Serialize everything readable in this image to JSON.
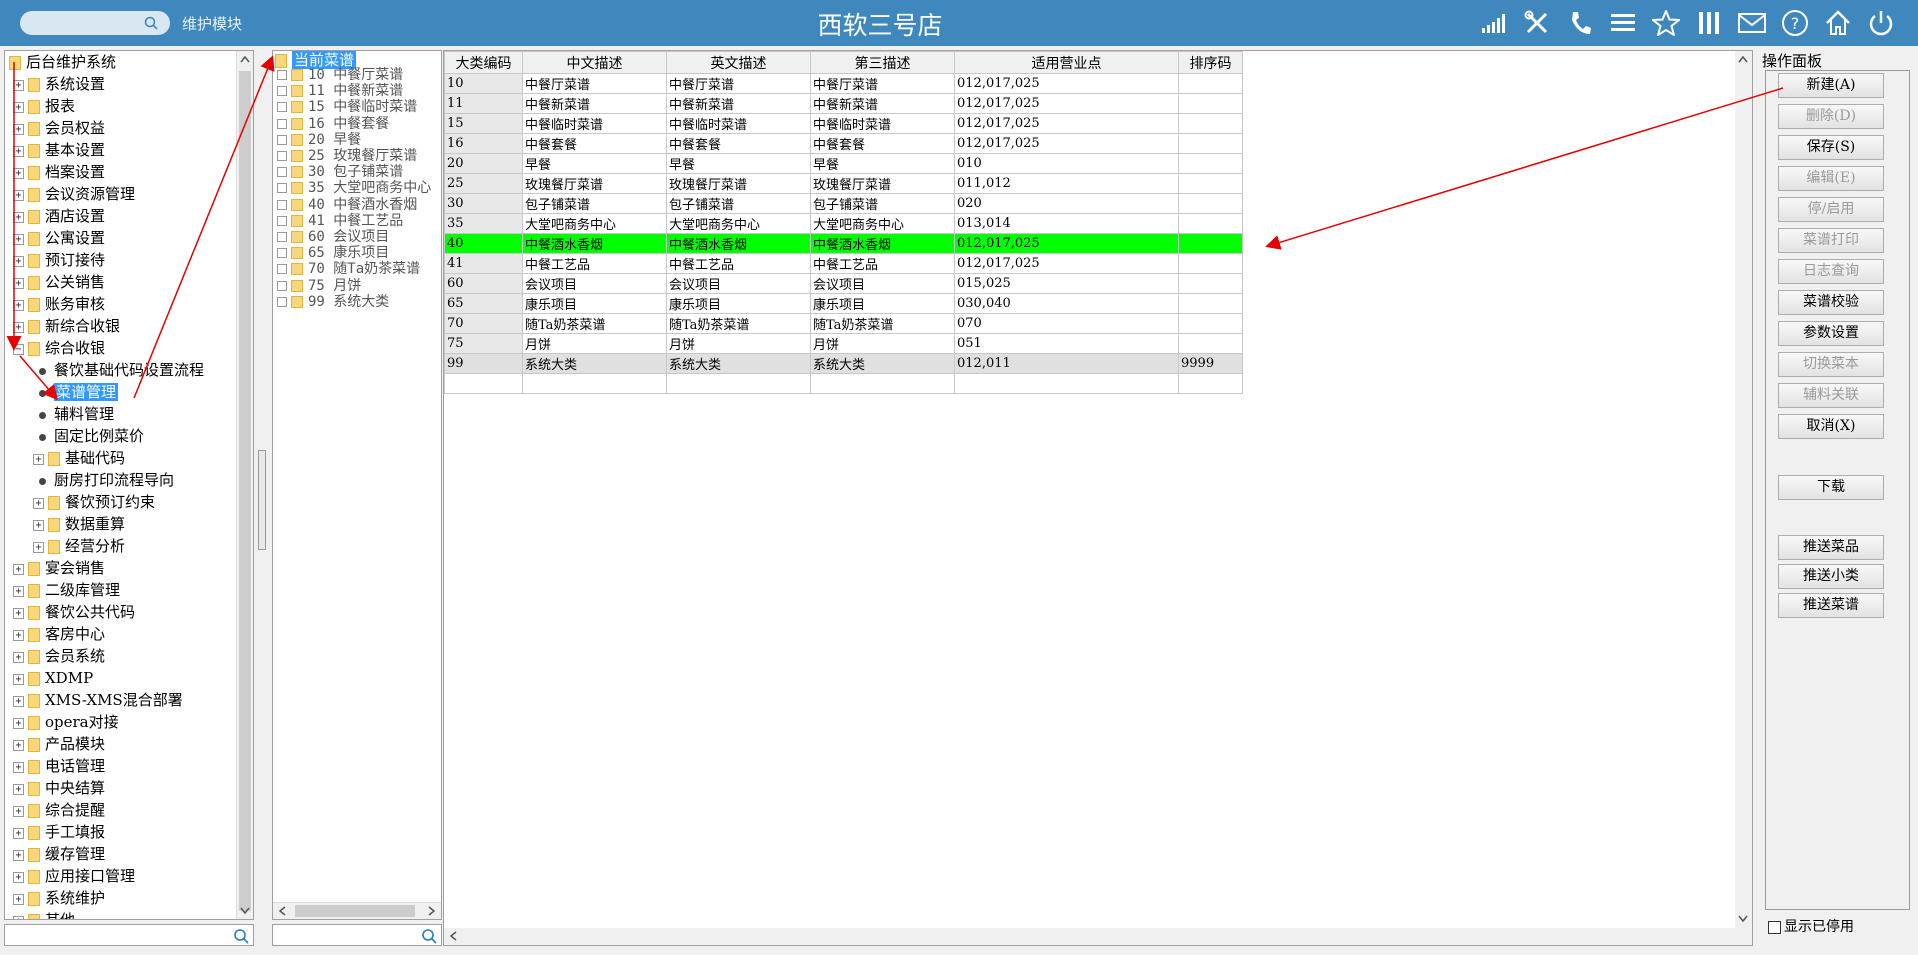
{
  "header": {
    "module_label": "维护模块",
    "title": "西软三号店",
    "icons": [
      "signal-icon",
      "tools-icon",
      "phone-icon",
      "menu-icon",
      "star-icon",
      "columns-icon",
      "mail-icon",
      "help-icon",
      "home-icon",
      "power-icon"
    ]
  },
  "left_tree": {
    "root": "后台维护系统",
    "items": [
      {
        "label": "系统设置",
        "level": 1,
        "type": "folder"
      },
      {
        "label": "报表",
        "level": 1,
        "type": "folder"
      },
      {
        "label": "会员权益",
        "level": 1,
        "type": "folder"
      },
      {
        "label": "基本设置",
        "level": 1,
        "type": "folder"
      },
      {
        "label": "档案设置",
        "level": 1,
        "type": "folder"
      },
      {
        "label": "会议资源管理",
        "level": 1,
        "type": "folder"
      },
      {
        "label": "酒店设置",
        "level": 1,
        "type": "folder"
      },
      {
        "label": "公寓设置",
        "level": 1,
        "type": "folder"
      },
      {
        "label": "预订接待",
        "level": 1,
        "type": "folder"
      },
      {
        "label": "公关销售",
        "level": 1,
        "type": "folder"
      },
      {
        "label": "账务审核",
        "level": 1,
        "type": "folder"
      },
      {
        "label": "新综合收银",
        "level": 1,
        "type": "folder"
      },
      {
        "label": "综合收银",
        "level": 1,
        "type": "folder",
        "expanded": true
      },
      {
        "label": "餐饮基础代码设置流程",
        "level": 2,
        "type": "leaf"
      },
      {
        "label": "菜谱管理",
        "level": 2,
        "type": "leaf",
        "selected": true
      },
      {
        "label": "辅料管理",
        "level": 2,
        "type": "leaf"
      },
      {
        "label": "固定比例菜价",
        "level": 2,
        "type": "leaf"
      },
      {
        "label": "基础代码",
        "level": 2,
        "type": "folder"
      },
      {
        "label": "厨房打印流程导向",
        "level": 2,
        "type": "leaf"
      },
      {
        "label": "餐饮预订约束",
        "level": 2,
        "type": "folder"
      },
      {
        "label": "数据重算",
        "level": 2,
        "type": "folder"
      },
      {
        "label": "经营分析",
        "level": 2,
        "type": "folder"
      },
      {
        "label": "宴会销售",
        "level": 1,
        "type": "folder"
      },
      {
        "label": "二级库管理",
        "level": 1,
        "type": "folder"
      },
      {
        "label": "餐饮公共代码",
        "level": 1,
        "type": "folder"
      },
      {
        "label": "客房中心",
        "level": 1,
        "type": "folder"
      },
      {
        "label": "会员系统",
        "level": 1,
        "type": "folder"
      },
      {
        "label": "XDMP",
        "level": 1,
        "type": "folder"
      },
      {
        "label": "XMS-XMS混合部署",
        "level": 1,
        "type": "folder"
      },
      {
        "label": "opera对接",
        "level": 1,
        "type": "folder"
      },
      {
        "label": "产品模块",
        "level": 1,
        "type": "folder"
      },
      {
        "label": "电话管理",
        "level": 1,
        "type": "folder"
      },
      {
        "label": "中央结算",
        "level": 1,
        "type": "folder"
      },
      {
        "label": "综合提醒",
        "level": 1,
        "type": "folder"
      },
      {
        "label": "手工填报",
        "level": 1,
        "type": "folder"
      },
      {
        "label": "缓存管理",
        "level": 1,
        "type": "folder"
      },
      {
        "label": "应用接口管理",
        "level": 1,
        "type": "folder"
      },
      {
        "label": "系统维护",
        "level": 1,
        "type": "folder"
      },
      {
        "label": "其他",
        "level": 1,
        "type": "folder"
      }
    ]
  },
  "mid_tree": {
    "root": "当前菜谱",
    "items": [
      "10  中餐厅菜谱",
      "11  中餐新菜谱",
      "15  中餐临时菜谱",
      "16  中餐套餐",
      "20  早餐",
      "25  玫瑰餐厅菜谱",
      "30  包子铺菜谱",
      "35  大堂吧商务中心",
      "40  中餐酒水香烟",
      "41  中餐工艺品",
      "60  会议项目",
      "65  康乐项目",
      "70  随Ta奶茶菜谱",
      "75  月饼",
      "99  系统大类"
    ]
  },
  "grid": {
    "columns": [
      "大类编码",
      "中文描述",
      "英文描述",
      "第三描述",
      "适用营业点",
      "排序码"
    ],
    "rows": [
      [
        "10",
        "中餐厅菜谱",
        "中餐厅菜谱",
        "中餐厅菜谱",
        "012,017,025",
        ""
      ],
      [
        "11",
        "中餐新菜谱",
        "中餐新菜谱",
        "中餐新菜谱",
        "012,017,025",
        ""
      ],
      [
        "15",
        "中餐临时菜谱",
        "中餐临时菜谱",
        "中餐临时菜谱",
        "012,017,025",
        ""
      ],
      [
        "16",
        "中餐套餐",
        "中餐套餐",
        "中餐套餐",
        "012,017,025",
        ""
      ],
      [
        "20",
        "早餐",
        "早餐",
        "早餐",
        "010",
        ""
      ],
      [
        "25",
        "玫瑰餐厅菜谱",
        "玫瑰餐厅菜谱",
        "玫瑰餐厅菜谱",
        "011,012",
        ""
      ],
      [
        "30",
        "包子铺菜谱",
        "包子铺菜谱",
        "包子铺菜谱",
        "020",
        ""
      ],
      [
        "35",
        "大堂吧商务中心",
        "大堂吧商务中心",
        "大堂吧商务中心",
        "013,014",
        ""
      ],
      [
        "40",
        "中餐酒水香烟",
        "中餐酒水香烟",
        "中餐酒水香烟",
        "012,017,025",
        ""
      ],
      [
        "41",
        "中餐工艺品",
        "中餐工艺品",
        "中餐工艺品",
        "012,017,025",
        ""
      ],
      [
        "60",
        "会议项目",
        "会议项目",
        "会议项目",
        "015,025",
        ""
      ],
      [
        "65",
        "康乐项目",
        "康乐项目",
        "康乐项目",
        "030,040",
        ""
      ],
      [
        "70",
        "随Ta奶茶菜谱",
        "随Ta奶茶菜谱",
        "随Ta奶茶菜谱",
        "070",
        ""
      ],
      [
        "75",
        "月饼",
        "月饼",
        "月饼",
        "051",
        ""
      ],
      [
        "99",
        "系统大类",
        "系统大类",
        "系统大类",
        "012,011",
        "9999"
      ]
    ],
    "highlight_row_color": "#00ff00"
  },
  "ops": {
    "title": "操作面板",
    "buttons": [
      {
        "label": "新建(A)",
        "enabled": true
      },
      {
        "label": "删除(D)",
        "enabled": false
      },
      {
        "label": "保存(S)",
        "enabled": true
      },
      {
        "label": "编辑(E)",
        "enabled": false
      },
      {
        "label": "停/启用",
        "enabled": false
      },
      {
        "label": "菜谱打印",
        "enabled": false
      },
      {
        "label": "日志查询",
        "enabled": false
      },
      {
        "label": "菜谱校验",
        "enabled": true
      },
      {
        "label": "参数设置",
        "enabled": true
      },
      {
        "label": "切换菜本",
        "enabled": false
      },
      {
        "label": "辅料关联",
        "enabled": false
      },
      {
        "label": "取消(X)",
        "enabled": true
      },
      {
        "label": "下载",
        "enabled": true
      },
      {
        "label": "推送菜品",
        "enabled": true
      },
      {
        "label": "推送小类",
        "enabled": true
      },
      {
        "label": "推送菜谱",
        "enabled": true
      }
    ],
    "show_disabled_label": "显示已停用"
  },
  "colors": {
    "header_bg": "#3e88bd",
    "annotation_arrow": "#e60000",
    "selection": "#3399ff"
  }
}
